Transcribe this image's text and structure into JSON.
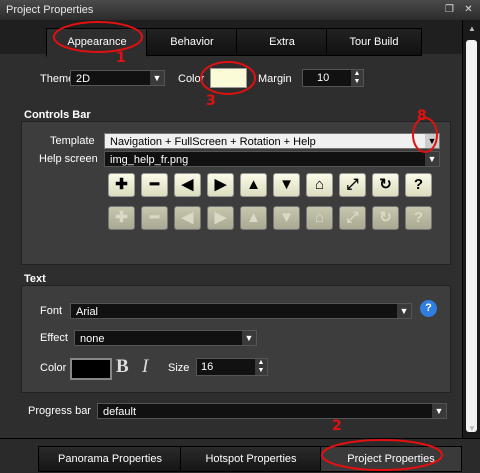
{
  "window": {
    "title": "Project Properties"
  },
  "top_tabs": [
    "Appearance",
    "Behavior",
    "Extra",
    "Tour Build"
  ],
  "theme": {
    "label": "Theme",
    "value": "2D"
  },
  "color": {
    "label": "Color",
    "value": "#fbfbd8"
  },
  "margin": {
    "label": "Margin",
    "value": "10"
  },
  "controls_bar": {
    "section_title": "Controls Bar",
    "template_label": "Template",
    "template_value": "Navigation + FullScreen + Rotation + Help",
    "help_label": "Help screen",
    "help_value": "img_help_fr.png",
    "buttons": [
      "plus-icon",
      "minus-icon",
      "arrow-left-icon",
      "arrow-right-icon",
      "arrow-up-icon",
      "arrow-down-icon",
      "home-icon",
      "fullscreen-icon",
      "rotate-icon",
      "help-icon"
    ]
  },
  "text_section": {
    "section_title": "Text",
    "font_label": "Font",
    "font_value": "Arial",
    "effect_label": "Effect",
    "effect_value": "none",
    "color_label": "Color",
    "color_value": "#000000",
    "bold_glyph": "B",
    "italic_glyph": "I",
    "size_label": "Size",
    "size_value": "16"
  },
  "progress_bar": {
    "label": "Progress bar",
    "value": "default"
  },
  "bottom_tabs": [
    "Panorama Properties",
    "Hotspot Properties",
    "Project Properties"
  ],
  "annotations": [
    "1",
    "2",
    "3",
    "8"
  ]
}
